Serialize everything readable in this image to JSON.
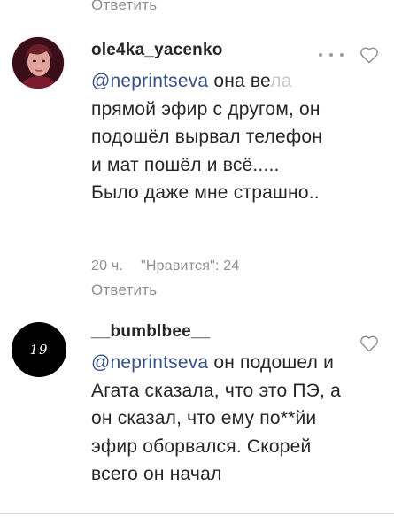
{
  "top_reply": {
    "label": "Ответить"
  },
  "comments": [
    {
      "username": "ole4ka_yacenko",
      "mention": "@neprintseva",
      "text_first": " она ве",
      "text_faded": "ла",
      "text_rest": " прямой эфир с другом, он подошёл вырвал телефон и мат пошёл и всё..... Было даже мне страшно..",
      "time": "20 ч.",
      "likes": "\"Нравится\": 24",
      "reply_label": "Ответить",
      "more_icon": "more-options-icon",
      "like_icon": "heart-outline-icon"
    },
    {
      "username": "__bumblbee__",
      "avatar_text": "19",
      "mention": "@neprintseva",
      "text": " он подошел и Агата сказала, что это ПЭ, а он сказал, что ему по**йи эфир оборвался. Скорей всего он начал",
      "like_icon": "heart-outline-icon"
    }
  ],
  "colors": {
    "text": "#262626",
    "mention": "#385185",
    "secondary": "#8e8e8e"
  }
}
